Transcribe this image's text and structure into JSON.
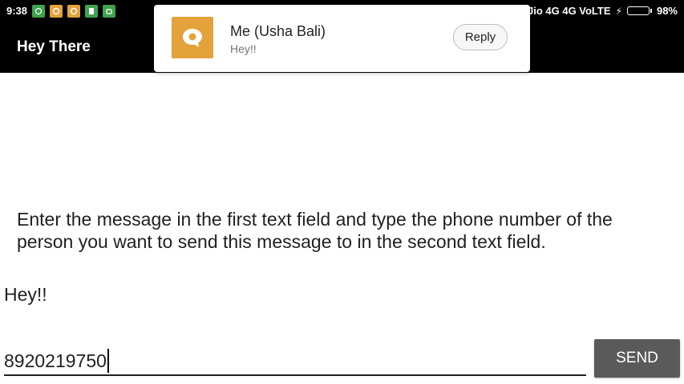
{
  "status_bar": {
    "time": "9:38",
    "carrier": "Jio 4G 4G VoLTE",
    "battery_percent": "98%",
    "battery_level": 0.98,
    "notification_icons": [
      "alarm-icon",
      "message-icon",
      "message-icon",
      "sim-icon",
      "android-icon"
    ]
  },
  "app": {
    "title": "Hey There"
  },
  "notification": {
    "icon": "chat-bubble-icon",
    "icon_color": "#e3a33a",
    "title": "Me (Usha Bali)",
    "text": "Hey!!",
    "reply_label": "Reply"
  },
  "main": {
    "instructions": "Enter the message in the first text field and type the phone number of the person you want to send this message to in the second text field.",
    "message_value": "Hey!!",
    "phone_value": "8920219750",
    "send_label": "SEND"
  }
}
